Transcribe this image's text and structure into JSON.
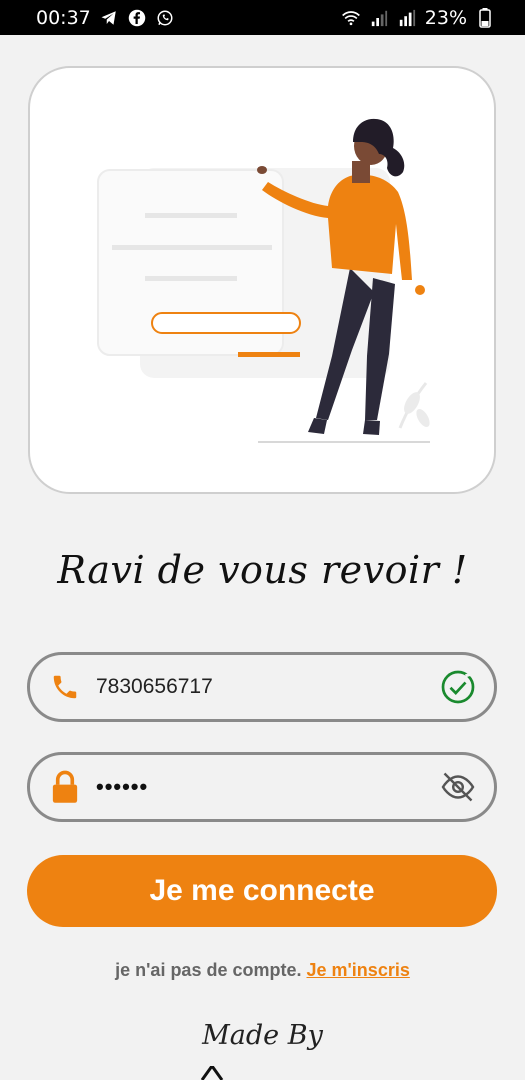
{
  "status_bar": {
    "time": "00:37",
    "left_icons": [
      "telegram-icon",
      "facebook-icon",
      "whatsapp-icon"
    ],
    "right_icons": [
      "wifi-icon",
      "signal-icon",
      "signal-r-icon"
    ],
    "battery": "23%"
  },
  "illustration": {
    "icon": "woman-with-login-form-illustration"
  },
  "welcome_text": "Ravi de vous revoir !",
  "phone_field": {
    "icon": "phone-icon",
    "value": "7830656717",
    "status_icon": "check-circle-icon"
  },
  "password_field": {
    "icon": "lock-icon",
    "masked_value": "••••••",
    "toggle_icon": "eye-off-icon"
  },
  "login_button": {
    "label": "Je me connecte"
  },
  "signup": {
    "prompt": "je n'ai pas de compte.",
    "link": "Je m'inscris"
  },
  "footer": {
    "made_by": "Made By"
  },
  "colors": {
    "accent": "#ee8211",
    "success": "#1a8a2e",
    "background": "#f2f2f2"
  }
}
